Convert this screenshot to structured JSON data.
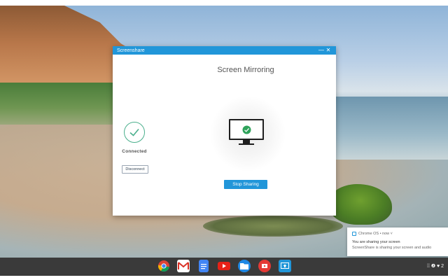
{
  "window": {
    "title": "Screenshare",
    "minimize_label": "—",
    "close_label": "✕",
    "heading": "Screen Mirroring",
    "status_text": "Connected",
    "disconnect_label": "Disconnect",
    "stop_label": "Stop Sharing"
  },
  "notification": {
    "source": "Chrome OS • now ˅",
    "title": "You are sharing your screen",
    "body": "ScreenShare is sharing your screen and audio"
  },
  "shelf": {
    "apps": [
      "chrome-icon",
      "gmail-icon",
      "docs-icon",
      "youtube-icon",
      "files-icon",
      "play-movies-icon",
      "screenshare-icon"
    ]
  },
  "tray": {
    "text": "⁞⁞ ❷ ♥ 2"
  },
  "colors": {
    "accent": "#2196d9",
    "success": "#4aaf8c",
    "shelf": "#3a3a3a"
  }
}
